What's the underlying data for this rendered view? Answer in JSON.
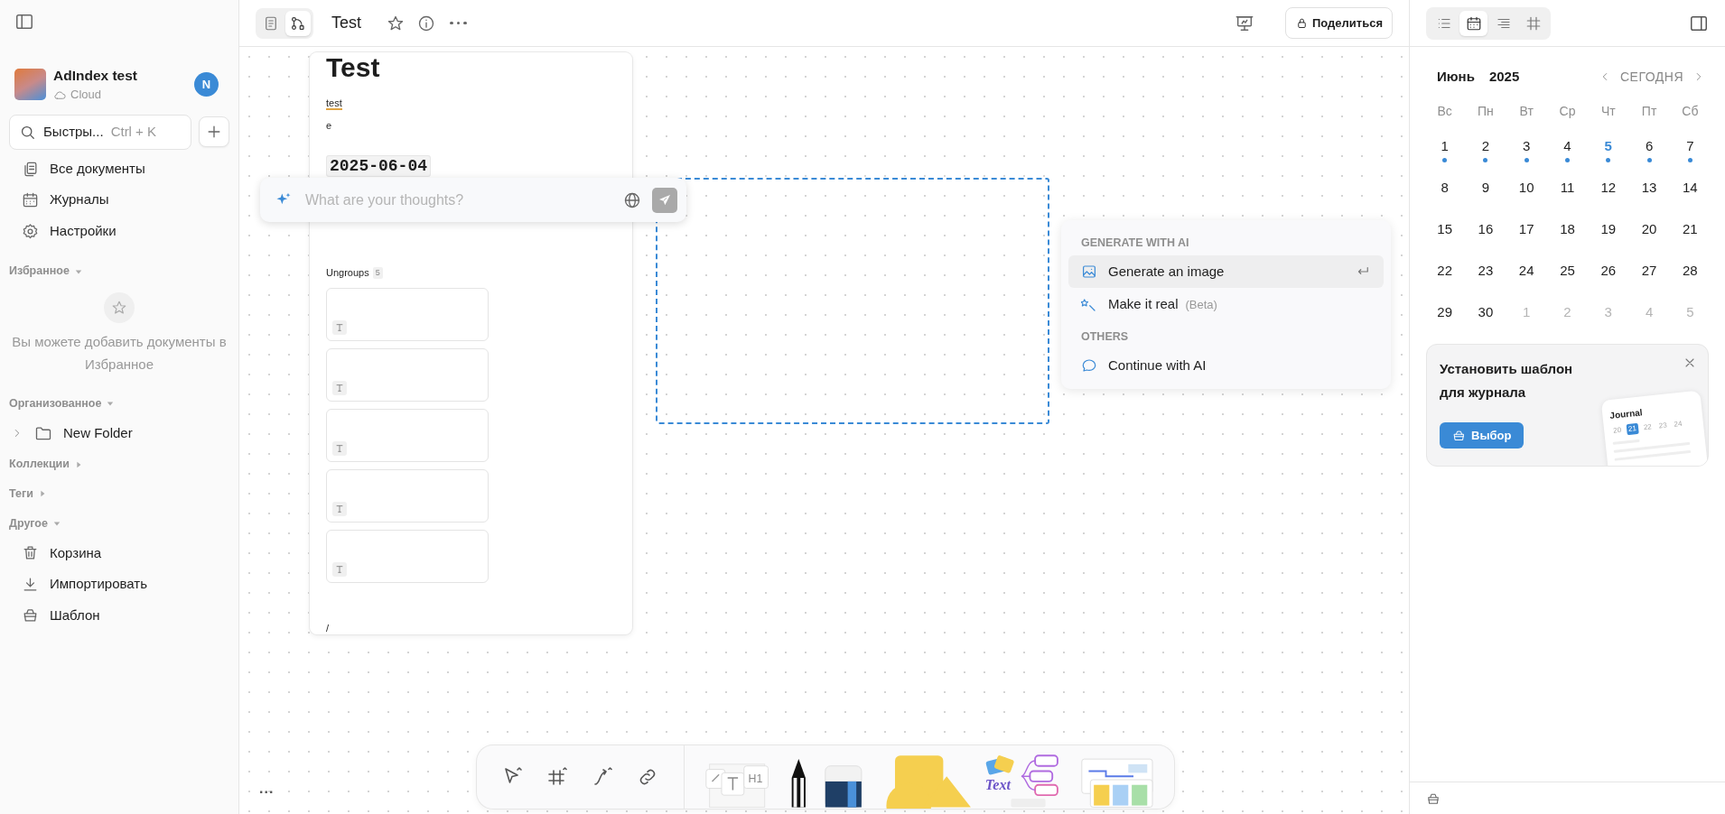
{
  "sidebar": {
    "workspace": {
      "name": "AdIndex test",
      "storage": "Cloud",
      "avatar_letter": "N"
    },
    "search": {
      "label": "Быстры...",
      "shortcut": "Ctrl + K"
    },
    "nav_items": [
      {
        "label": "Все документы"
      },
      {
        "label": "Журналы"
      },
      {
        "label": "Настройки"
      }
    ],
    "favorites": {
      "title": "Избранное",
      "expanded": true,
      "empty_text": "Вы можете добавить документы в Избранное"
    },
    "organized": {
      "title": "Организованное",
      "expanded": true,
      "folders": [
        {
          "label": "New Folder",
          "expanded": false
        }
      ]
    },
    "collections": {
      "title": "Коллекции",
      "expanded": false
    },
    "tags": {
      "title": "Теги",
      "expanded": false
    },
    "other": {
      "title": "Другое",
      "expanded": true,
      "items": [
        {
          "label": "Корзина"
        },
        {
          "label": "Импортировать"
        },
        {
          "label": "Шаблон"
        }
      ]
    }
  },
  "top_bar": {
    "mode_toggle": [
      {
        "kind": "page",
        "selected": false
      },
      {
        "kind": "edgeless",
        "selected": true
      }
    ],
    "title": "Test",
    "share_button": "Поделиться"
  },
  "canvas": {
    "document": {
      "title": "Test",
      "lines": [
        "test",
        "e"
      ],
      "date_heading": "2025-06-04",
      "group": {
        "label": "Ungroups",
        "count": "5",
        "cards": [
          {
            "kind": "text"
          },
          {
            "kind": "text"
          },
          {
            "kind": "text"
          },
          {
            "kind": "text"
          },
          {
            "kind": "text"
          }
        ]
      },
      "trailing_text": "/"
    },
    "ai_input": {
      "placeholder": "What are your thoughts?"
    },
    "ai_menu": {
      "sections": [
        {
          "title": "GENERATE WITH AI",
          "items": [
            {
              "label": "Generate an image",
              "selected": true
            },
            {
              "label": "Make it real",
              "badge": "(Beta)",
              "selected": false
            }
          ]
        },
        {
          "title": "OTHERS",
          "items": [
            {
              "label": "Continue with AI",
              "selected": false
            }
          ]
        }
      ]
    },
    "more_button": "...",
    "toolbar": {
      "tools": [
        {
          "kind": "select"
        },
        {
          "kind": "frame"
        },
        {
          "kind": "connector"
        },
        {
          "kind": "link"
        }
      ],
      "drawings": [
        {
          "kind": "notes",
          "label": "H1"
        },
        {
          "kind": "pen"
        },
        {
          "kind": "eraser"
        },
        {
          "kind": "shapes"
        },
        {
          "kind": "mindmap",
          "label": "Text"
        },
        {
          "kind": "templates"
        }
      ]
    }
  },
  "right_panel": {
    "tabs": [
      {
        "kind": "outline",
        "selected": false
      },
      {
        "kind": "calendar",
        "selected": true
      },
      {
        "kind": "toc",
        "selected": false
      },
      {
        "kind": "frames",
        "selected": false
      }
    ],
    "calendar": {
      "month": "Июнь",
      "year": "2025",
      "today_button": "СЕГОДНЯ",
      "weekdays": [
        "Вс",
        "Пн",
        "Вт",
        "Ср",
        "Чт",
        "Пт",
        "Сб"
      ],
      "days": [
        {
          "label": "1",
          "outside": false,
          "today": false,
          "has_entry": true
        },
        {
          "label": "2",
          "outside": false,
          "today": false,
          "has_entry": true
        },
        {
          "label": "3",
          "outside": false,
          "today": false,
          "has_entry": true
        },
        {
          "label": "4",
          "outside": false,
          "today": false,
          "has_entry": true
        },
        {
          "label": "5",
          "outside": false,
          "today": true,
          "has_entry": true
        },
        {
          "label": "6",
          "outside": false,
          "today": false,
          "has_entry": true
        },
        {
          "label": "7",
          "outside": false,
          "today": false,
          "has_entry": true
        },
        {
          "label": "8",
          "outside": false,
          "today": false,
          "has_entry": false
        },
        {
          "label": "9",
          "outside": false,
          "today": false,
          "has_entry": false
        },
        {
          "label": "10",
          "outside": false,
          "today": false,
          "has_entry": false
        },
        {
          "label": "11",
          "outside": false,
          "today": false,
          "has_entry": false
        },
        {
          "label": "12",
          "outside": false,
          "today": false,
          "has_entry": false
        },
        {
          "label": "13",
          "outside": false,
          "today": false,
          "has_entry": false
        },
        {
          "label": "14",
          "outside": false,
          "today": false,
          "has_entry": false
        },
        {
          "label": "15",
          "outside": false,
          "today": false,
          "has_entry": false
        },
        {
          "label": "16",
          "outside": false,
          "today": false,
          "has_entry": false
        },
        {
          "label": "17",
          "outside": false,
          "today": false,
          "has_entry": false
        },
        {
          "label": "18",
          "outside": false,
          "today": false,
          "has_entry": false
        },
        {
          "label": "19",
          "outside": false,
          "today": false,
          "has_entry": false
        },
        {
          "label": "20",
          "outside": false,
          "today": false,
          "has_entry": false
        },
        {
          "label": "21",
          "outside": false,
          "today": false,
          "has_entry": false
        },
        {
          "label": "22",
          "outside": false,
          "today": false,
          "has_entry": false
        },
        {
          "label": "23",
          "outside": false,
          "today": false,
          "has_entry": false
        },
        {
          "label": "24",
          "outside": false,
          "today": false,
          "has_entry": false
        },
        {
          "label": "25",
          "outside": false,
          "today": false,
          "has_entry": false
        },
        {
          "label": "26",
          "outside": false,
          "today": false,
          "has_entry": false
        },
        {
          "label": "27",
          "outside": false,
          "today": false,
          "has_entry": false
        },
        {
          "label": "28",
          "outside": false,
          "today": false,
          "has_entry": false
        },
        {
          "label": "29",
          "outside": false,
          "today": false,
          "has_entry": false
        },
        {
          "label": "30",
          "outside": false,
          "today": false,
          "has_entry": false
        },
        {
          "label": "1",
          "outside": true,
          "today": false,
          "has_entry": false
        },
        {
          "label": "2",
          "outside": true,
          "today": false,
          "has_entry": false
        },
        {
          "label": "3",
          "outside": true,
          "today": false,
          "has_entry": false
        },
        {
          "label": "4",
          "outside": true,
          "today": false,
          "has_entry": false
        },
        {
          "label": "5",
          "outside": true,
          "today": false,
          "has_entry": false
        }
      ]
    },
    "promo": {
      "title": "Установить шаблон для журнала",
      "button": "Выбор",
      "preview": {
        "title": "Journal",
        "days": [
          {
            "label": "20",
            "selected": false
          },
          {
            "label": "21",
            "selected": true
          },
          {
            "label": "22",
            "selected": false
          },
          {
            "label": "23",
            "selected": false
          },
          {
            "label": "24",
            "selected": false
          }
        ]
      }
    }
  }
}
